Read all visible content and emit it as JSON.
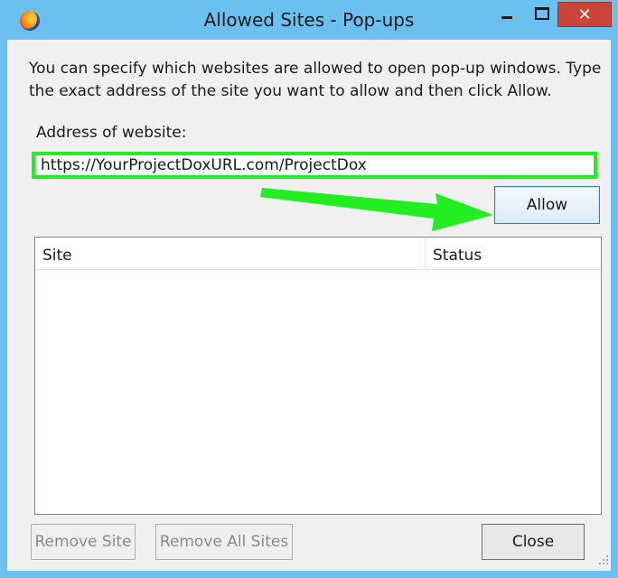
{
  "window": {
    "title": "Allowed Sites - Pop-ups",
    "close_glyph": "✕",
    "icon": "firefox-icon"
  },
  "content": {
    "description": "You can specify which websites are allowed to open pop-up windows. Type\nthe exact address of the site you want to allow and then click Allow.",
    "address_label": "Address of website:",
    "address_value": "https://YourProjectDoxURL.com/ProjectDox",
    "allow_label": "Allow"
  },
  "table": {
    "columns": [
      "Site",
      "Status"
    ],
    "rows": []
  },
  "buttons": {
    "remove_site": "Remove Site",
    "remove_all": "Remove All Sites",
    "close": "Close"
  },
  "colors": {
    "titlebar": "#6cc0ef",
    "highlight": "#22ee22",
    "close_button": "#c9453a"
  }
}
